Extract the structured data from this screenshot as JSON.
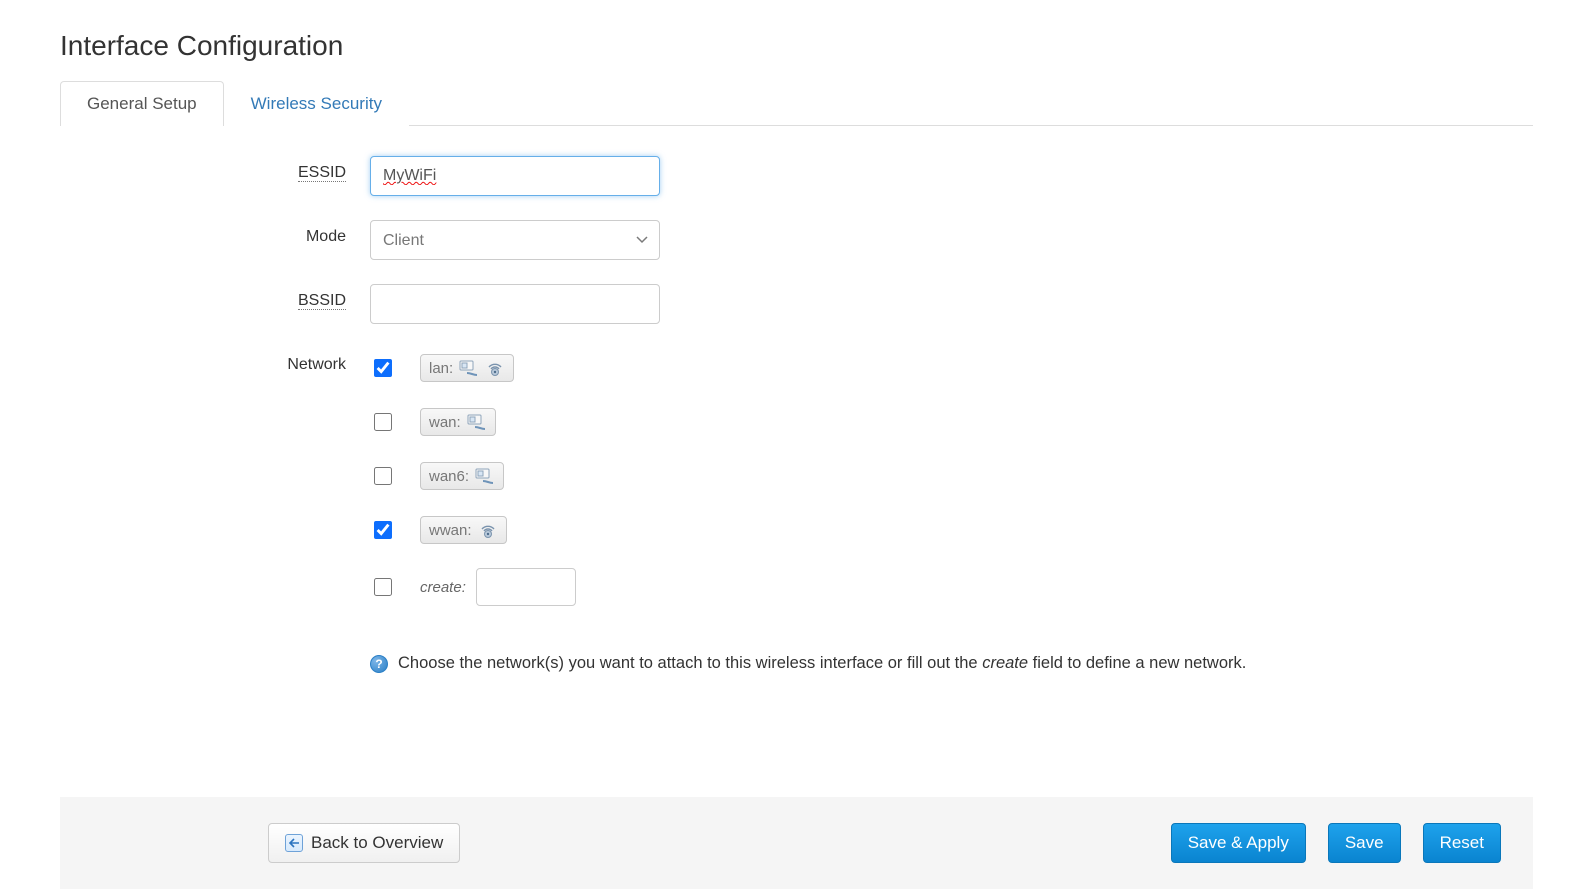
{
  "page": {
    "title": "Interface Configuration"
  },
  "tabs": {
    "general": "General Setup",
    "security": "Wireless Security"
  },
  "form": {
    "essid_label": "ESSID",
    "essid_value": "MyWiFi",
    "mode_label": "Mode",
    "mode_value": "Client",
    "bssid_label": "BSSID",
    "bssid_value": "",
    "network_label": "Network"
  },
  "networks": {
    "items": [
      {
        "label": "lan:",
        "checked": true,
        "icons": [
          "nic",
          "wifi"
        ]
      },
      {
        "label": "wan:",
        "checked": false,
        "icons": [
          "nic"
        ]
      },
      {
        "label": "wan6:",
        "checked": false,
        "icons": [
          "nic"
        ]
      },
      {
        "label": "wwan:",
        "checked": true,
        "icons": [
          "wifi"
        ]
      }
    ],
    "create_label": "create:",
    "create_value": ""
  },
  "help": {
    "text_before": "Choose the network(s) you want to attach to this wireless interface or fill out the ",
    "em": "create",
    "text_after": " field to define a new network."
  },
  "footer": {
    "back": "Back to Overview",
    "save_apply": "Save & Apply",
    "save": "Save",
    "reset": "Reset"
  }
}
